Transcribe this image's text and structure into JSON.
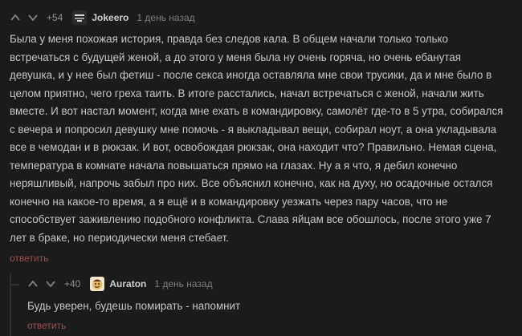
{
  "comments": [
    {
      "rating": "+54",
      "author": "Jokeero",
      "time": "1 день назад",
      "lines": [
        "Была у меня похожая история, правда без следов кала. В общем начали только только",
        "встречаться с будущей женой, а до этого у меня была ну очень горяча, но очень ебанутая",
        "девушка, и у нее был фетиш - после секса иногда оставляла мне свои трусики, да и мне было в",
        "целом приятно, чего греха таить. В итоге расстались, начал встречаться с женой, начали жить",
        "вместе. И вот настал момент, когда мне ехать в командировку, самолёт где-то в 5 утра, собирался",
        "с вечера и попросил девушку мне помочь - я выкладывал вещи, собирал ноут, а она укладывала",
        "все в чемодан и в рюкзак. И вот, освобождая рюкзак, она находит что? Правильно. Немая сцена,",
        "температура в комнате начала повышаться прямо на глазах. Ну а я что, я дебил конечно",
        "неряшливый, напрочь забыл про них. Все объяснил конечно, как на духу, но осадочные остался",
        "конечно на какое-то время, а я ещё и в командировку уезжать через пару часов, что не",
        "способствует заживлению подобного конфликта. Слава яйцам все обошлось, после этого уже 7",
        "лет в браке, но периодически меня стебает."
      ],
      "reply_label": "ответить",
      "avatar_icon": "dark-striped-avatar"
    },
    {
      "rating": "+40",
      "author": "Auraton",
      "time": "1 день назад",
      "lines": [
        "Будь уверен, будешь помирать - напомнит"
      ],
      "reply_label": "ответить",
      "avatar_icon": "smiling-face-avatar"
    }
  ],
  "colors": {
    "background": "#1b1b1b",
    "text": "#c4c4c4",
    "muted": "#7d7d7d",
    "reply_link": "#a84a4a"
  }
}
